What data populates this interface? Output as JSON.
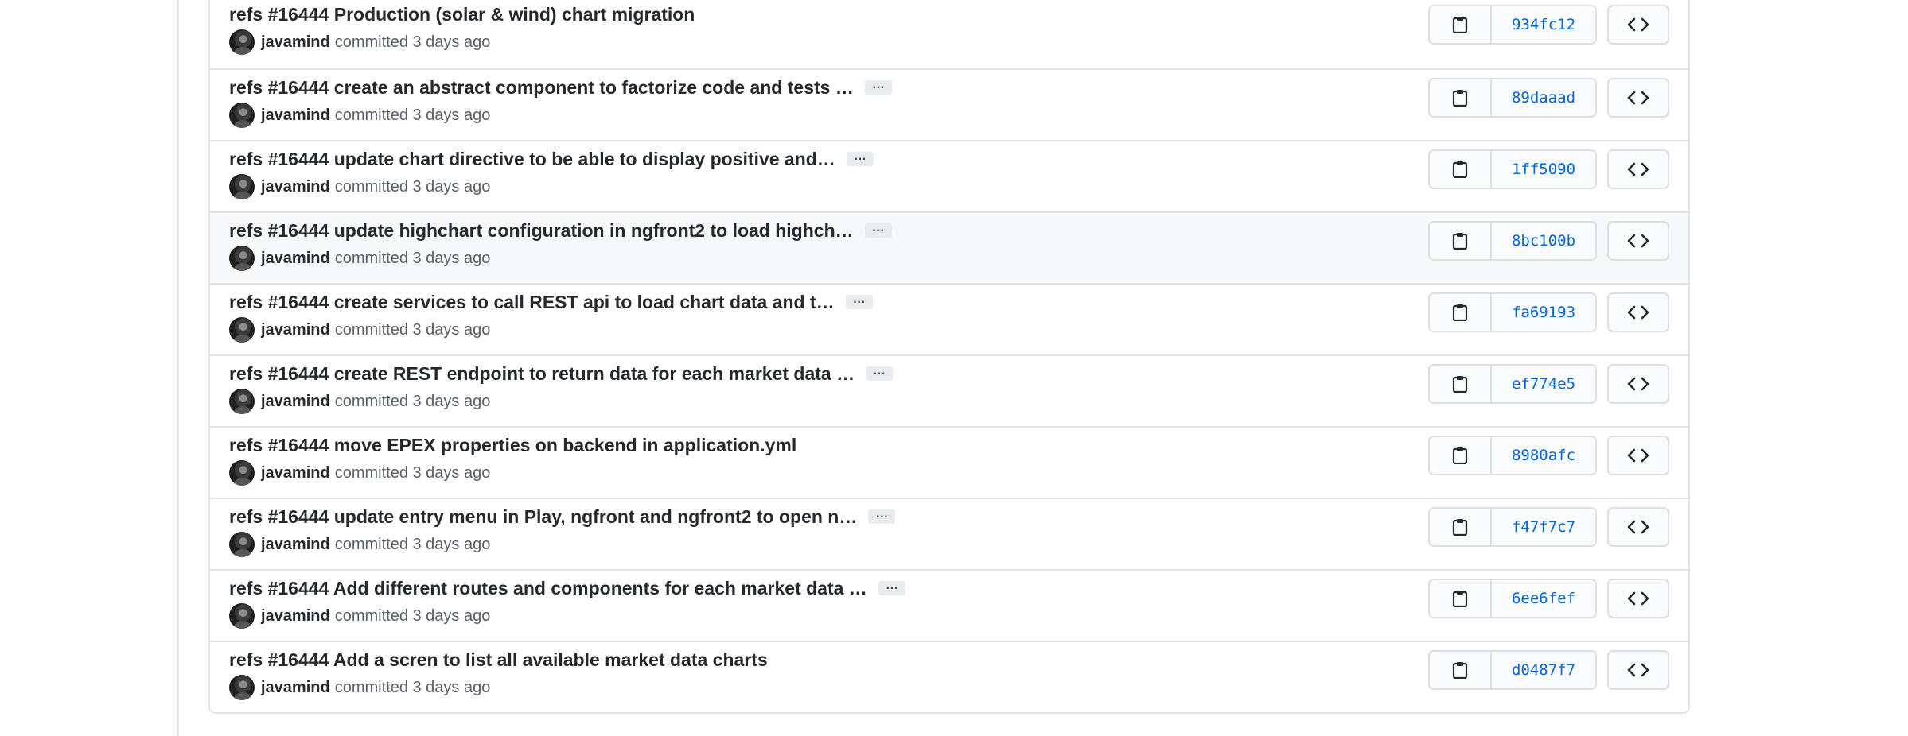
{
  "commits": [
    {
      "title": "refs #16444 Production (solar & wind) chart migration",
      "truncated": false,
      "author": "javamind",
      "committed": "committed 3 days ago",
      "sha": "934fc12"
    },
    {
      "title": "refs #16444 create an abstract component to factorize code and tests …",
      "truncated": true,
      "author": "javamind",
      "committed": "committed 3 days ago",
      "sha": "89daaad"
    },
    {
      "title": "refs #16444 update chart directive to be able to display positive and…",
      "truncated": true,
      "author": "javamind",
      "committed": "committed 3 days ago",
      "sha": "1ff5090"
    },
    {
      "title": "refs #16444 update highchart configuration in ngfront2 to load highch…",
      "truncated": true,
      "author": "javamind",
      "committed": "committed 3 days ago",
      "sha": "8bc100b"
    },
    {
      "title": "refs #16444 create services to call REST api to load chart data and t…",
      "truncated": true,
      "author": "javamind",
      "committed": "committed 3 days ago",
      "sha": "fa69193"
    },
    {
      "title": "refs #16444 create REST endpoint to return data for each market data …",
      "truncated": true,
      "author": "javamind",
      "committed": "committed 3 days ago",
      "sha": "ef774e5"
    },
    {
      "title": "refs #16444 move EPEX properties on backend in application.yml",
      "truncated": false,
      "author": "javamind",
      "committed": "committed 3 days ago",
      "sha": "8980afc"
    },
    {
      "title": "refs #16444 update entry menu in Play, ngfront and ngfront2 to open n…",
      "truncated": true,
      "author": "javamind",
      "committed": "committed 3 days ago",
      "sha": "f47f7c7"
    },
    {
      "title": "refs #16444 Add different routes and components for each market data …",
      "truncated": true,
      "author": "javamind",
      "committed": "committed 3 days ago",
      "sha": "6ee6fef"
    },
    {
      "title": "refs #16444 Add a scren to list all available market data charts",
      "truncated": false,
      "author": "javamind",
      "committed": "committed 3 days ago",
      "sha": "d0487f7"
    }
  ],
  "ellipsis_label": "…",
  "hover_index": 3,
  "icons": {
    "copy": "clipboard-icon",
    "browse": "code-icon"
  },
  "colors": {
    "sha_link": "#0366d6",
    "hover_bg": "#f6f8fa",
    "border": "#e1e4e8"
  }
}
